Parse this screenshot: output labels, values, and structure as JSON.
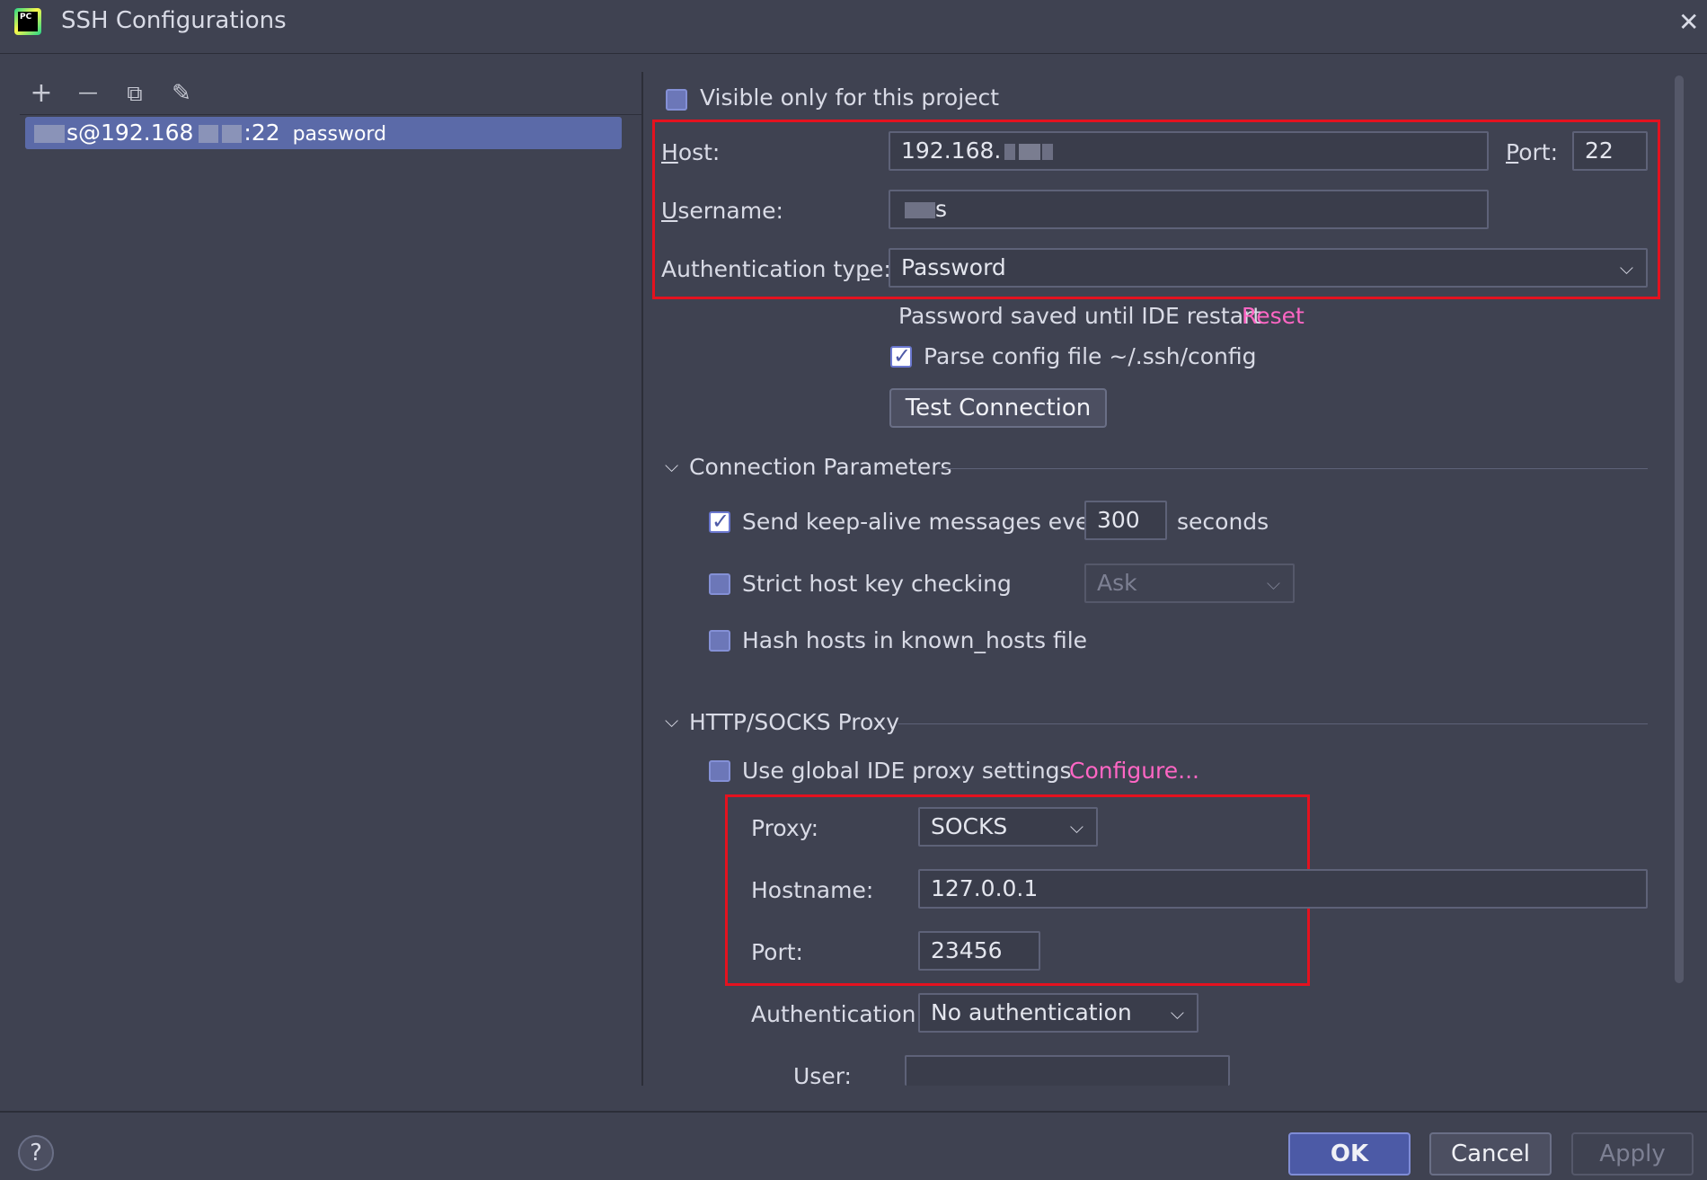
{
  "window": {
    "title": "SSH Configurations",
    "close": "✕"
  },
  "left": {
    "toolbar": {
      "add": "+",
      "remove": "—",
      "copy": "⧉",
      "edit": "✎"
    },
    "hosts": [
      {
        "user_suffix": "s@192.168",
        "port_suffix": ":22",
        "auth": "password"
      }
    ]
  },
  "form": {
    "visible_only": {
      "label": "Visible only for this project",
      "checked": false
    },
    "host": {
      "label_u": "H",
      "label_rest": "ost:",
      "value": "192.168."
    },
    "port": {
      "label_u": "P",
      "label_rest": "ort:",
      "value": "22"
    },
    "username": {
      "label_u": "U",
      "label_rest": "sername:",
      "value": "s"
    },
    "auth_type": {
      "label_pre": "Authentication ty",
      "label_u": "p",
      "label_post": "e:",
      "value": "Password"
    },
    "password_note": "Password saved until IDE restart",
    "reset_link": "Reset",
    "parse_config": {
      "label": "Parse config file ~/.ssh/config",
      "checked": true
    },
    "test_connection": "Test Connection"
  },
  "connection_params": {
    "header": "Connection Parameters",
    "keep_alive": {
      "label": "Send keep-alive messages every",
      "value": "300",
      "unit": "seconds",
      "checked": true
    },
    "strict_host": {
      "label": "Strict host key checking",
      "value": "Ask",
      "checked": false
    },
    "hash_hosts": {
      "label": "Hash hosts in known_hosts file",
      "checked": false
    }
  },
  "proxy": {
    "header": "HTTP/SOCKS Proxy",
    "use_global": {
      "label": "Use global IDE proxy settings",
      "checked": false
    },
    "configure_link": "Configure...",
    "proxy_type": {
      "label": "Proxy:",
      "value": "SOCKS"
    },
    "hostname": {
      "label": "Hostname:",
      "value": "127.0.0.1"
    },
    "port": {
      "label": "Port:",
      "value": "23456"
    },
    "authentication": {
      "label": "Authentication:",
      "value": "No authentication"
    },
    "user": {
      "label": "User:",
      "value": ""
    }
  },
  "footer": {
    "help": "?",
    "ok": "OK",
    "cancel": "Cancel",
    "apply": "Apply"
  },
  "colors": {
    "background": "#3f4251",
    "selection": "#5b6aa8",
    "link": "#ff66c4",
    "highlight_box": "#e4121f"
  }
}
